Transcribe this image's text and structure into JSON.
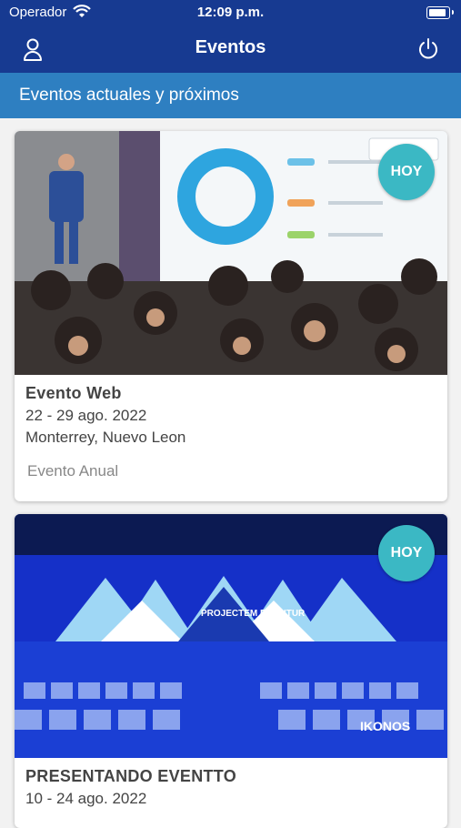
{
  "status_bar": {
    "carrier": "Operador",
    "time": "12:09 p.m."
  },
  "nav": {
    "title": "Eventos"
  },
  "section": {
    "title": "Eventos actuales y próximos"
  },
  "events": [
    {
      "name": "Evento Web",
      "dates": "22 - 29 ago. 2022",
      "location": "Monterrey, Nuevo Leon",
      "type": "Evento Anual",
      "badge": "HOY"
    },
    {
      "name": "PRESENTANDO EVENTTO",
      "dates": "10 - 24 ago. 2022",
      "badge": "HOY",
      "stage_text": "PROJECTEM EL FUTUR",
      "logo": "IKONOS"
    }
  ],
  "colors": {
    "nav_bg": "#173a91",
    "subheader_bg": "#2e7fc1",
    "badge_bg": "#3bb8c4"
  }
}
